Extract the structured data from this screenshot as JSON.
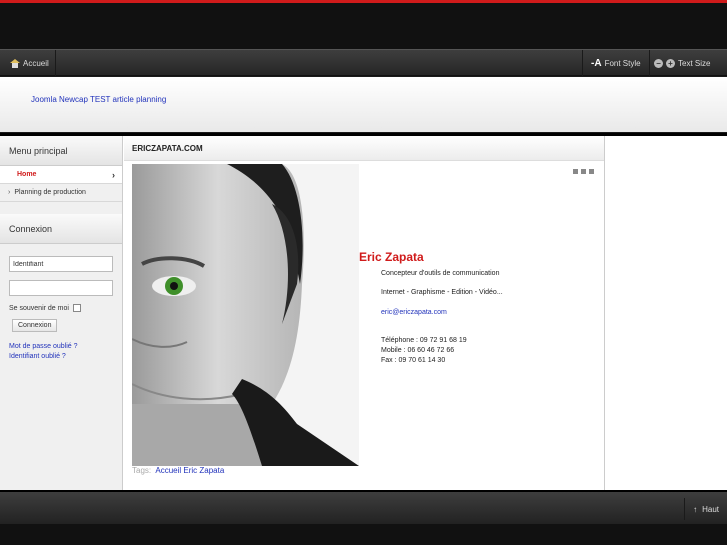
{
  "nav": {
    "home_label": "Accueil",
    "font_style_label": "Font Style",
    "text_size_label": "Text Size"
  },
  "header": {
    "link": "Joomla Newcap TEST article planning"
  },
  "sidebar": {
    "menu_heading": "Menu principal",
    "menu_items": [
      {
        "label": "Home"
      },
      {
        "label": "Planning de production"
      }
    ],
    "login_heading": "Connexion",
    "username_value": "Identifiant",
    "remember_label": "Se souvenir de moi",
    "login_button": "Connexion",
    "forgot_password": "Mot de passe oublié ?",
    "forgot_username": "Identifiant oublié ?"
  },
  "article": {
    "title": "ERICZAPATA.COM",
    "name": "Eric Zapata",
    "role": "Concepteur d'outils de communication",
    "services": "Internet - Graphisme - Edition - Vidéo...",
    "email": "eric@ericzapata.com",
    "phone": "Téléphone : 09 72 91 68 19",
    "mobile": "Mobile : 06 60 46 72 66",
    "fax": "Fax : 09 70 61 14 30",
    "tags_label": "Tags:",
    "tags": "Accueil Eric Zapata"
  },
  "footer": {
    "top_label": "Haut"
  },
  "colors": {
    "accent": "#d01b1b",
    "link": "#2233bb"
  }
}
